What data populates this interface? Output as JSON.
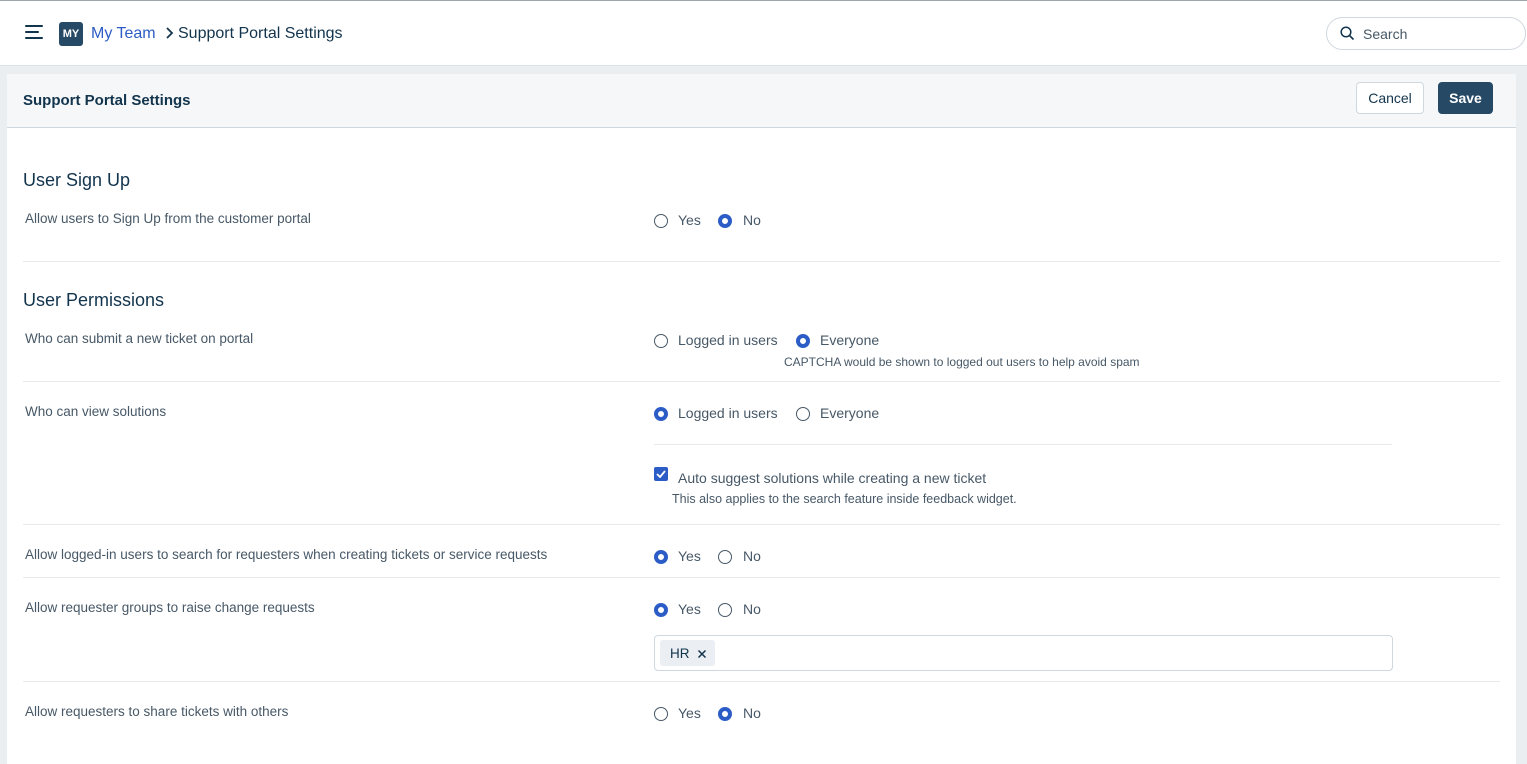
{
  "header": {
    "team_badge": "MY",
    "breadcrumb_team": "My Team",
    "breadcrumb_current": "Support Portal Settings",
    "search_placeholder": "Search"
  },
  "panel": {
    "title": "Support Portal Settings",
    "cancel_label": "Cancel",
    "save_label": "Save"
  },
  "user_signup": {
    "title": "User Sign Up",
    "allow_signup": {
      "label": "Allow users to Sign Up from the customer portal",
      "options": [
        "Yes",
        "No"
      ],
      "selected": "No"
    }
  },
  "user_permissions": {
    "title": "User Permissions",
    "submit_ticket": {
      "label": "Who can submit a new ticket on portal",
      "options": [
        "Logged in users",
        "Everyone"
      ],
      "selected": "Everyone",
      "hint": "CAPTCHA would be shown to logged out users to help avoid spam"
    },
    "view_solutions": {
      "label": "Who can view solutions",
      "options": [
        "Logged in users",
        "Everyone"
      ],
      "selected": "Logged in users",
      "auto_suggest_label": "Auto suggest solutions while creating a new ticket",
      "auto_suggest_checked": true,
      "auto_suggest_hint": "This also applies to the search feature inside feedback widget."
    },
    "search_requesters": {
      "label": "Allow logged-in users to search for requesters when creating tickets or service requests",
      "options": [
        "Yes",
        "No"
      ],
      "selected": "Yes"
    },
    "change_requests": {
      "label": "Allow requester groups to raise change requests",
      "options": [
        "Yes",
        "No"
      ],
      "selected": "Yes",
      "tags": [
        "HR"
      ]
    },
    "share_tickets": {
      "label": "Allow requesters to share tickets with others",
      "options": [
        "Yes",
        "No"
      ],
      "selected": "No"
    }
  },
  "colors": {
    "accent": "#2c5cc5",
    "primary_button": "#264966",
    "text": "#12344d",
    "muted_text": "#475867"
  }
}
